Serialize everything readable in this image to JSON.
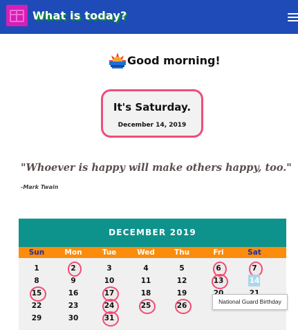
{
  "app_bar": {
    "title": "What is today?",
    "logo_icon": "calendar-icon",
    "menu_icon": "hamburger-menu-icon",
    "background": "#1f4bb8"
  },
  "greeting": {
    "icon": "sunrise-icon",
    "text": "Good morning!"
  },
  "day_card": {
    "title": "It's Saturday.",
    "date": "December 14, 2019",
    "border_color": "#ee4d7a"
  },
  "quote": {
    "text": "\"Whoever is happy will make others happy, too.\"",
    "author": "-Mark Twain"
  },
  "calendar": {
    "month_label": "DECEMBER 2019",
    "header_color": "#0e928c",
    "weekday_bar_color": "#fb8c0c",
    "weekdays": [
      "Sun",
      "Mon",
      "Tue",
      "Wed",
      "Thu",
      "Fri",
      "Sat"
    ],
    "weeks": [
      [
        "1",
        "2",
        "3",
        "4",
        "5",
        "6",
        "7"
      ],
      [
        "8",
        "9",
        "10",
        "11",
        "12",
        "13",
        "14"
      ],
      [
        "15",
        "16",
        "17",
        "18",
        "19",
        "20",
        "21"
      ],
      [
        "22",
        "23",
        "24",
        "25",
        "26",
        "",
        ""
      ],
      [
        "29",
        "30",
        "31",
        "",
        "",
        "",
        ""
      ]
    ],
    "event_days": [
      "2",
      "6",
      "7",
      "13",
      "15",
      "17",
      "24",
      "25",
      "26",
      "31"
    ],
    "event_color": "#f04a72",
    "today": "14",
    "today_color": "#a9d7ec"
  },
  "tooltip": {
    "text": "National Guard Birthday"
  }
}
